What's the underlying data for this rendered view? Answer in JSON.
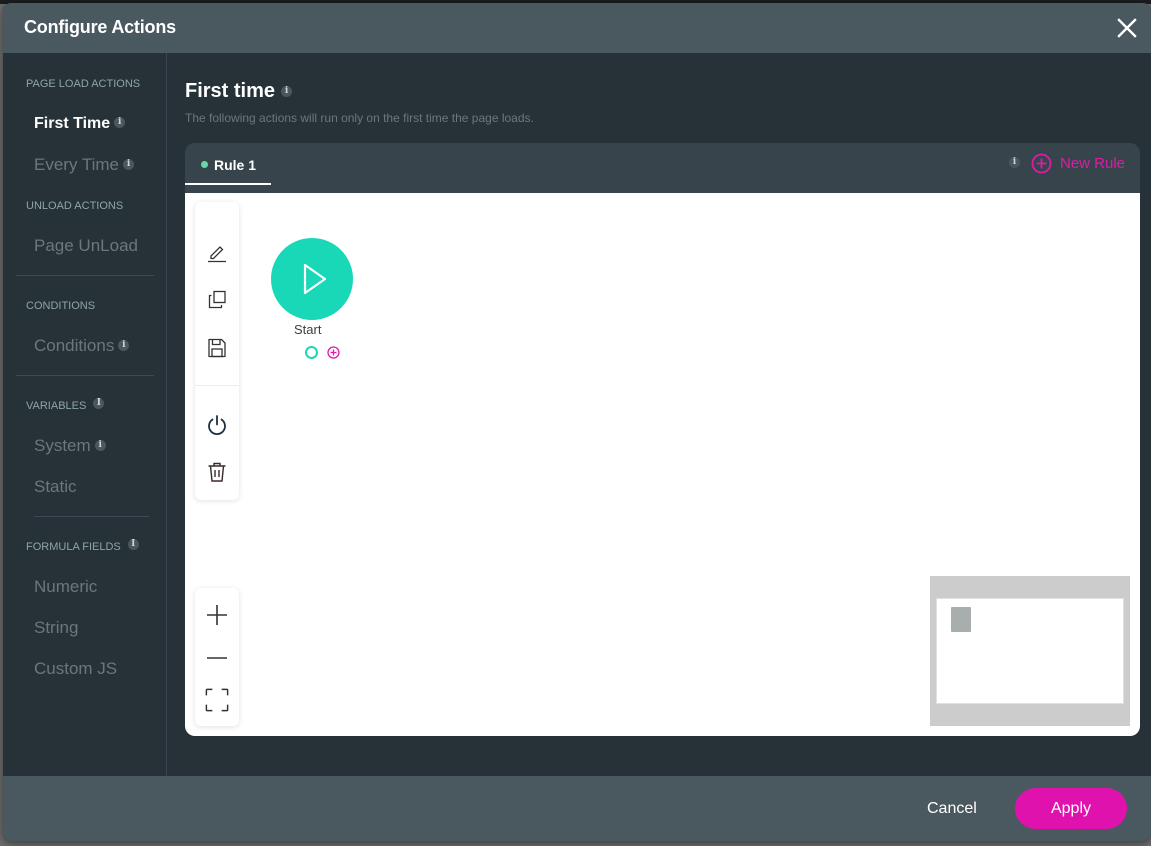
{
  "dialog": {
    "title": "Configure Actions",
    "close_icon": "close-icon"
  },
  "sidebar": {
    "sections": [
      {
        "label": "PAGE LOAD ACTIONS",
        "items": [
          {
            "label": "First Time",
            "info": true,
            "active": true
          },
          {
            "label": "Every Time",
            "info": true,
            "active": false
          }
        ]
      },
      {
        "label": "UNLOAD ACTIONS",
        "items": [
          {
            "label": "Page UnLoad",
            "info": false,
            "active": false
          }
        ]
      },
      {
        "label": "CONDITIONS",
        "items": [
          {
            "label": "Conditions",
            "info": true,
            "active": false
          }
        ]
      },
      {
        "label": "VARIABLES",
        "info": true,
        "items": [
          {
            "label": "System",
            "info": true,
            "active": false
          },
          {
            "label": "Static",
            "info": false,
            "active": false
          }
        ]
      },
      {
        "label": "FORMULA FIELDS",
        "info": true,
        "items": [
          {
            "label": "Numeric",
            "info": false,
            "active": false
          },
          {
            "label": "String",
            "info": false,
            "active": false
          },
          {
            "label": "Custom JS",
            "info": false,
            "active": false
          }
        ]
      }
    ],
    "info_glyph": "i"
  },
  "main": {
    "title": "First time",
    "subtitle": "The following actions will run only on the first time the page loads.",
    "rules": [
      {
        "label": "Rule 1",
        "status_color": "#6ad7a8",
        "active": true
      }
    ],
    "new_rule_label": "New Rule",
    "canvas": {
      "toolbar": [
        "edit-icon",
        "duplicate-icon",
        "save-icon",
        "power-icon",
        "trash-icon"
      ],
      "zoom_controls": [
        "zoom-in-icon",
        "zoom-out-icon",
        "fit-screen-icon"
      ],
      "nodes": [
        {
          "label": "Start",
          "type": "start",
          "color": "#19d8b8"
        }
      ]
    }
  },
  "footer": {
    "cancel_label": "Cancel",
    "apply_label": "Apply"
  },
  "colors": {
    "accent": "#e012ad",
    "start_node": "#19d8b8",
    "header_bg": "#4a5860",
    "body_bg": "#263238"
  }
}
